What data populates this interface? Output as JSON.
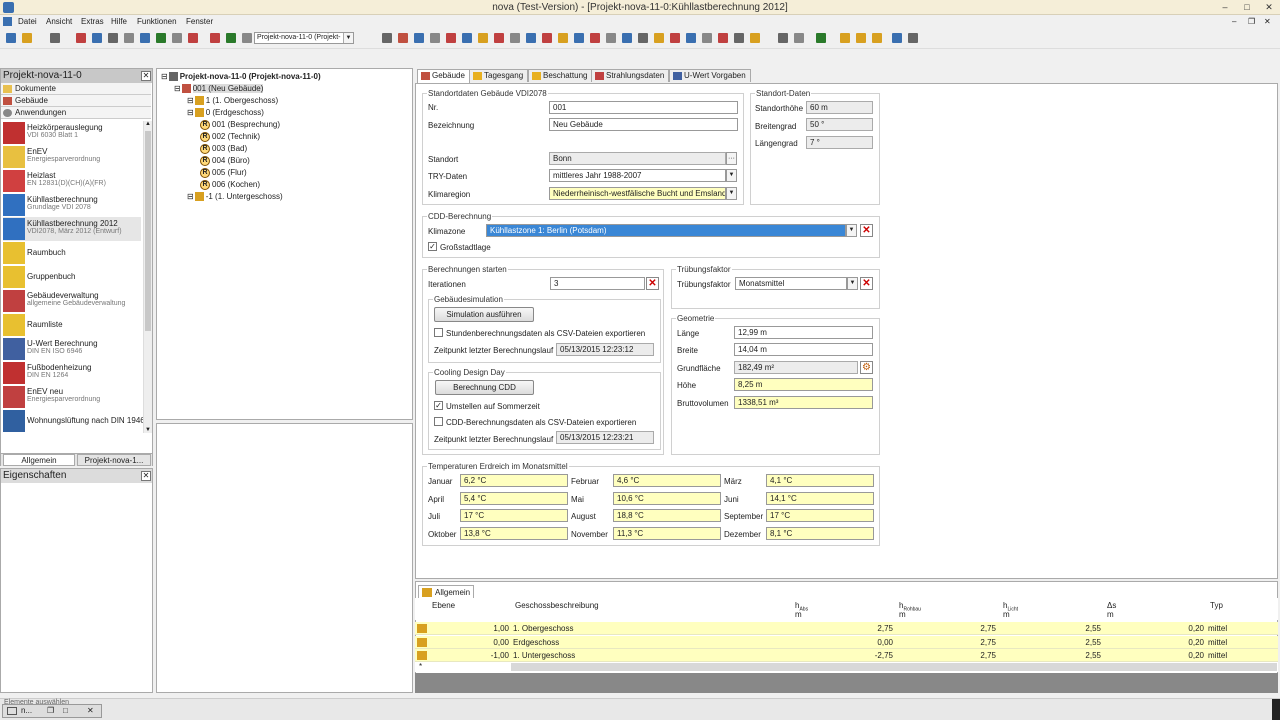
{
  "window": {
    "title": "nova (Test-Version) - [Projekt-nova-11-0:Kühllastberechnung 2012]",
    "min": "–",
    "max": "□",
    "close": "✕"
  },
  "menu": [
    "Datei",
    "Ansicht",
    "Extras",
    "Hilfe",
    "Funktionen",
    "Fenster"
  ],
  "toolbar": {
    "project_combo": "Projekt-nova-11-0 (Projekt-"
  },
  "left_panel": {
    "title": "Projekt-nova-11-0",
    "nav": [
      "Dokumente",
      "Gebäude",
      "Anwendungen"
    ],
    "apps": [
      {
        "l1": "Heizkörperauslegung",
        "l2": "VDI 6030 Blatt 1",
        "icon": "radiator-icon",
        "color": "#c03030"
      },
      {
        "l1": "EnEV",
        "l2": "Energiesparverordnung",
        "icon": "lightbulb-icon",
        "color": "#e8c040"
      },
      {
        "l1": "Heizlast",
        "l2": "EN 12831(D)(CH)(A)(FR)",
        "icon": "thermometer-icon",
        "color": "#d04040"
      },
      {
        "l1": "Kühllastberechnung",
        "l2": "Grundlage VDI 2078",
        "icon": "snowflake-icon",
        "color": "#3070c0"
      },
      {
        "l1": "Kühllastberechnung 2012",
        "l2": "VDI2078, März 2012 (Entwurf)",
        "icon": "snowflake-icon",
        "color": "#3070c0"
      },
      {
        "l1": "Raumbuch",
        "l2": "",
        "icon": "grid-book-icon",
        "color": "#e8c030"
      },
      {
        "l1": "Gruppenbuch",
        "l2": "",
        "icon": "grid-book-icon",
        "color": "#e8c030"
      },
      {
        "l1": "Gebäudeverwaltung",
        "l2": "allgemeine Gebäudeverwaltung",
        "icon": "house-icon",
        "color": "#c04040"
      },
      {
        "l1": "Raumliste",
        "l2": "",
        "icon": "room-list-icon",
        "color": "#e8c030"
      },
      {
        "l1": "U-Wert Berechnung",
        "l2": "DIN EN ISO 6946",
        "icon": "wall-icon",
        "color": "#4060a0"
      },
      {
        "l1": "Fußbodenheizung",
        "l2": "DIN EN 1264",
        "icon": "floor-heating-icon",
        "color": "#c03030"
      },
      {
        "l1": "EnEV neu",
        "l2": "Energiesparverordnung",
        "icon": "house-icon",
        "color": "#c04040"
      },
      {
        "l1": "Wohnungslüftung nach DIN 1946",
        "l2": "",
        "icon": "arrow-icon",
        "color": "#3060a0"
      }
    ],
    "bottom_tabs": [
      "Allgemein",
      "Projekt-nova-1..."
    ],
    "props_title": "Eigenschaften"
  },
  "tree": [
    {
      "label": "Projekt-nova-11-0 (Projekt-nova-11-0)",
      "indent": 0,
      "kind": "project"
    },
    {
      "label": "001 (Neu Gebäude)",
      "indent": 1,
      "kind": "building"
    },
    {
      "label": "1 (1. Obergeschoss)",
      "indent": 2,
      "kind": "floor"
    },
    {
      "label": "0 (Erdgeschoss)",
      "indent": 2,
      "kind": "floor"
    },
    {
      "label": "001 (Besprechung)",
      "indent": 3,
      "kind": "room"
    },
    {
      "label": "002 (Technik)",
      "indent": 3,
      "kind": "room"
    },
    {
      "label": "003 (Bad)",
      "indent": 3,
      "kind": "room"
    },
    {
      "label": "004 (Büro)",
      "indent": 3,
      "kind": "room"
    },
    {
      "label": "005 (Flur)",
      "indent": 3,
      "kind": "room"
    },
    {
      "label": "006 (Kochen)",
      "indent": 3,
      "kind": "room"
    },
    {
      "label": "-1 (1. Untergeschoss)",
      "indent": 2,
      "kind": "floor"
    }
  ],
  "tabs": [
    "Gebäude",
    "Tagesgang",
    "Beschattung",
    "Strahlungsdaten",
    "U-Wert Vorgaben"
  ],
  "standort_daten_gebaeude": {
    "title": "Standortdaten Gebäude VDI2078",
    "nr_label": "Nr.",
    "nr": "001",
    "bez_label": "Bezeichnung",
    "bez": "Neu Gebäude",
    "standort_label": "Standort",
    "standort": "Bonn",
    "try_label": "TRY-Daten",
    "try": "mittleres Jahr 1988-2007",
    "klima_label": "Klimaregion",
    "klima": "Niederrheinisch-westfälische Bucht und Emsland"
  },
  "standort_daten": {
    "title": "Standort-Daten",
    "hoehe_label": "Standorthöhe",
    "hoehe": "60 m",
    "breite_label": "Breitengrad",
    "breite": "50 °",
    "laenge_label": "Längengrad",
    "laenge": "7 °"
  },
  "cdd": {
    "title": "CDD-Berechnung",
    "klimazone_label": "Klimazone",
    "klimazone": "Kühllastzone 1: Berlin (Potsdam)",
    "grossstadt": "Großstadtlage"
  },
  "berechnungen": {
    "title": "Berechnungen starten",
    "iter_label": "Iterationen",
    "iter": "3",
    "sim_title": "Gebäudesimulation",
    "sim_btn": "Simulation ausführen",
    "sim_csv": "Stundenberechnungsdaten als CSV-Dateien exportieren",
    "sim_time_label": "Zeitpunkt letzter Berechnungslauf",
    "sim_time": "05/13/2015 12:23:12",
    "cdd_title": "Cooling Design Day",
    "cdd_btn": "Berechnung CDD",
    "cdd_summer": "Umstellen auf Sommerzeit",
    "cdd_csv": "CDD-Berechnungsdaten als CSV-Dateien exportieren",
    "cdd_time_label": "Zeitpunkt letzter Berechnungslauf",
    "cdd_time": "05/13/2015 12:23:21"
  },
  "truebung": {
    "title": "Trübungsfaktor",
    "label": "Trübungsfaktor",
    "value": "Monatsmittel"
  },
  "geometrie": {
    "title": "Geometrie",
    "laenge_label": "Länge",
    "laenge": "12,99 m",
    "breite_label": "Breite",
    "breite": "14,04 m",
    "grund_label": "Grundfläche",
    "grund": "182,49 m²",
    "hoehe_label": "Höhe",
    "hoehe": "8,25 m",
    "brutto_label": "Bruttovolumen",
    "brutto": "1338,51 m³"
  },
  "temperaturen": {
    "title": "Temperaturen Erdreich im Monatsmittel",
    "months": [
      {
        "m": "Januar",
        "v": "6,2 °C"
      },
      {
        "m": "Februar",
        "v": "4,6 °C"
      },
      {
        "m": "März",
        "v": "4,1 °C"
      },
      {
        "m": "April",
        "v": "5,4 °C"
      },
      {
        "m": "Mai",
        "v": "10,6 °C"
      },
      {
        "m": "Juni",
        "v": "14,1 °C"
      },
      {
        "m": "Juli",
        "v": "17 °C"
      },
      {
        "m": "August",
        "v": "18,8 °C"
      },
      {
        "m": "September",
        "v": "17 °C"
      },
      {
        "m": "Oktober",
        "v": "13,8 °C"
      },
      {
        "m": "November",
        "v": "11,3 °C"
      },
      {
        "m": "Dezember",
        "v": "8,1 °C"
      }
    ]
  },
  "grid": {
    "tab": "Allgemein",
    "headers": {
      "ebene": "Ebene",
      "beschr": "Geschossbeschreibung",
      "h_abs": "h",
      "h_abs_sub": "Abs",
      "h_rohbau": "h",
      "h_rohbau_sub": "Rohbau",
      "h_licht": "h",
      "h_licht_sub": "Licht",
      "ds": "Δs",
      "typ": "Typ",
      "unit": "m"
    },
    "rows": [
      {
        "ebene": "1,00",
        "beschr": "1. Obergeschoss",
        "h_abs": "2,75",
        "h_rohbau": "2,75",
        "h_licht": "2,55",
        "ds": "0,20",
        "typ": "mittel"
      },
      {
        "ebene": "0,00",
        "beschr": "Erdgeschoss",
        "h_abs": "0,00",
        "h_rohbau": "2,75",
        "h_licht": "2,55",
        "ds": "0,20",
        "typ": "mittel"
      },
      {
        "ebene": "-1,00",
        "beschr": "1. Untergeschoss",
        "h_abs": "-2,75",
        "h_rohbau": "2,75",
        "h_licht": "2,55",
        "ds": "0,20",
        "typ": "mittel"
      }
    ],
    "new_row": "*"
  },
  "status": {
    "text": "Elemente auswählen",
    "task": "n..."
  }
}
